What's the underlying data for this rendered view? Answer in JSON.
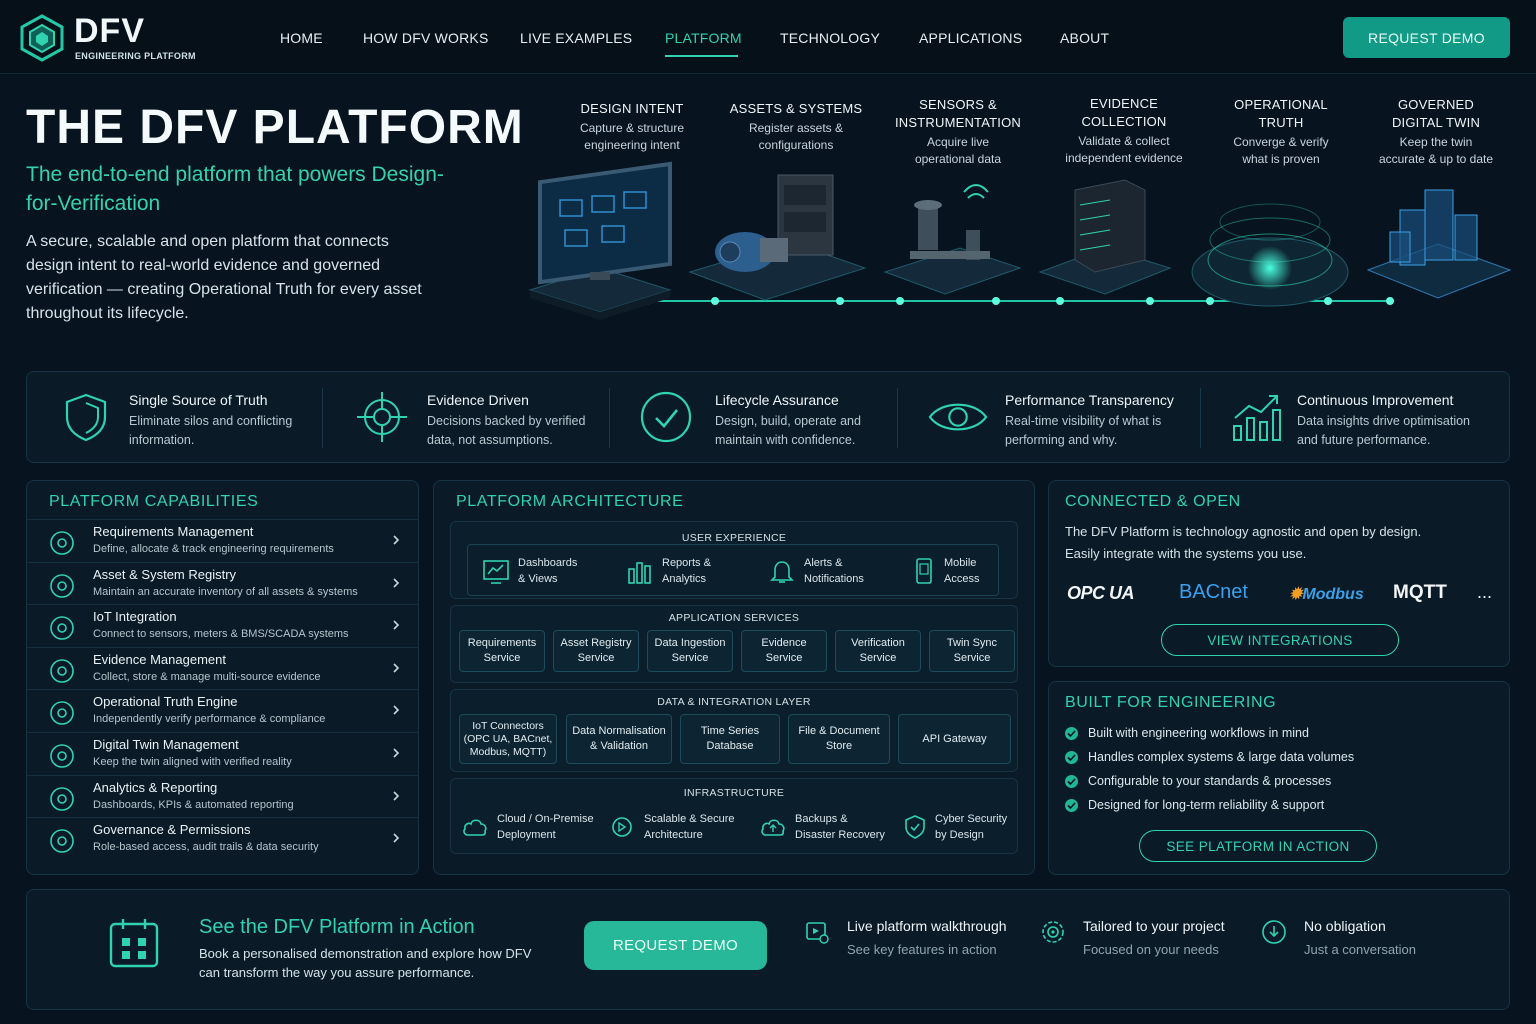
{
  "brand": {
    "name": "DFV",
    "tagline": "ENGINEERING PLATFORM"
  },
  "nav": {
    "items": [
      {
        "label": "HOME"
      },
      {
        "label": "HOW DFV WORKS"
      },
      {
        "label": "LIVE EXAMPLES"
      },
      {
        "label": "PLATFORM",
        "active": true
      },
      {
        "label": "TECHNOLOGY"
      },
      {
        "label": "APPLICATIONS"
      },
      {
        "label": "ABOUT"
      }
    ],
    "cta": "REQUEST DEMO"
  },
  "hero": {
    "title": "THE DFV PLATFORM",
    "subtitle": "The end-to-end platform that powers Design-for-Verification",
    "body": "A secure, scalable and open platform that connects design intent to real-world evidence and governed verification — creating Operational Truth for every asset throughout its lifecycle."
  },
  "pipeline": [
    {
      "title": "DESIGN INTENT",
      "desc": "Capture & structure engineering intent"
    },
    {
      "title": "ASSETS & SYSTEMS",
      "desc": "Register assets & configurations"
    },
    {
      "title": "SENSORS & INSTRUMENTATION",
      "desc": "Acquire live operational data"
    },
    {
      "title": "EVIDENCE COLLECTION",
      "desc": "Validate & collect independent evidence"
    },
    {
      "title": "OPERATIONAL TRUTH",
      "desc": "Converge & verify what is proven"
    },
    {
      "title": "GOVERNED DIGITAL TWIN",
      "desc": "Keep the twin accurate & up to date"
    }
  ],
  "features": [
    {
      "title": "Single Source of Truth",
      "desc": "Eliminate silos and conflicting information.",
      "icon": "shield-icon"
    },
    {
      "title": "Evidence Driven",
      "desc": "Decisions backed by verified data, not assumptions.",
      "icon": "crosshair-icon"
    },
    {
      "title": "Lifecycle Assurance",
      "desc": "Design, build, operate and maintain with confidence.",
      "icon": "check-circle-icon"
    },
    {
      "title": "Performance Transparency",
      "desc": "Real-time visibility of what is performing and why.",
      "icon": "eye-icon"
    },
    {
      "title": "Continuous Improvement",
      "desc": "Data insights drive optimisation and future performance.",
      "icon": "growth-chart-icon"
    }
  ],
  "capabilities": {
    "heading": "PLATFORM CAPABILITIES",
    "items": [
      {
        "title": "Requirements Management",
        "desc": "Define, allocate & track engineering requirements"
      },
      {
        "title": "Asset & System Registry",
        "desc": "Maintain an accurate inventory of all assets & systems"
      },
      {
        "title": "IoT Integration",
        "desc": "Connect to sensors, meters & BMS/SCADA systems"
      },
      {
        "title": "Evidence Management",
        "desc": "Collect, store & manage multi-source evidence"
      },
      {
        "title": "Operational Truth Engine",
        "desc": "Independently verify performance & compliance"
      },
      {
        "title": "Digital Twin Management",
        "desc": "Keep the twin aligned with verified reality"
      },
      {
        "title": "Analytics & Reporting",
        "desc": "Dashboards, KPIs & automated reporting"
      },
      {
        "title": "Governance & Permissions",
        "desc": "Role-based access, audit trails & data security"
      }
    ]
  },
  "architecture": {
    "heading": "PLATFORM ARCHITECTURE",
    "ux": {
      "title": "USER EXPERIENCE",
      "items": [
        "Dashboards\n& Views",
        "Reports &\nAnalytics",
        "Alerts &\nNotifications",
        "Mobile\nAccess"
      ]
    },
    "services": {
      "title": "APPLICATION SERVICES",
      "items": [
        "Requirements\nService",
        "Asset Registry\nService",
        "Data Ingestion\nService",
        "Evidence\nService",
        "Verification\nService",
        "Twin Sync\nService"
      ]
    },
    "data": {
      "title": "DATA & INTEGRATION LAYER",
      "items": [
        "IoT Connectors\n(OPC UA, BACnet,\nModbus, MQTT)",
        "Data Normalisation\n& Validation",
        "Time Series\nDatabase",
        "File & Document\nStore",
        "API Gateway"
      ]
    },
    "infra": {
      "title": "INFRASTRUCTURE",
      "items": [
        "Cloud / On-Premise\nDeployment",
        "Scalable & Secure\nArchitecture",
        "Backups &\nDisaster Recovery",
        "Cyber Security\nby Design"
      ]
    }
  },
  "connected": {
    "heading": "CONNECTED & OPEN",
    "body": "The DFV Platform is technology agnostic and open by design. Easily integrate with the systems you use.",
    "logos": [
      "OPC UA",
      "BACnet",
      "Modbus",
      "MQTT",
      "..."
    ],
    "button": "VIEW INTEGRATIONS"
  },
  "built": {
    "heading": "BUILT FOR ENGINEERING",
    "items": [
      "Built with engineering workflows in mind",
      "Handles complex systems & large data volumes",
      "Configurable to your standards & processes",
      "Designed for long-term reliability & support"
    ],
    "button": "SEE PLATFORM IN ACTION"
  },
  "cta": {
    "title": "See the DFV Platform in Action",
    "body": "Book a personalised demonstration and explore how DFV can transform the way you assure performance.",
    "button": "REQUEST DEMO",
    "perks": [
      {
        "title": "Live platform walkthrough",
        "desc": "See key features in action"
      },
      {
        "title": "Tailored to your project",
        "desc": "Focused on your needs"
      },
      {
        "title": "No obligation",
        "desc": "Just a conversation"
      }
    ]
  },
  "colors": {
    "accent": "#2fd3b0",
    "button": "#119a85",
    "background": "#07131f"
  }
}
